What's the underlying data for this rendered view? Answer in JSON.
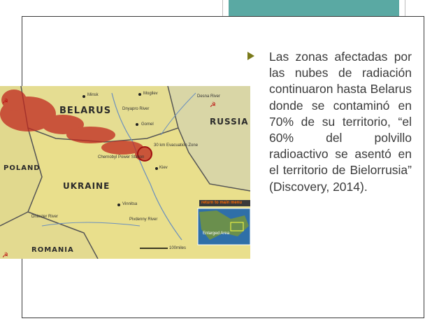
{
  "slide": {
    "bullet_icon": "right-triangle-icon",
    "bullet_text": "Las zonas afectadas por las nubes de radiación continuaron hasta Belarus donde se contaminó en 70% de su territorio, “el 60% del polvillo radioactivo se asentó en el territorio de Bielorrusia” (Discovery, 2014).",
    "accent_color": "#5aa9a3"
  },
  "map": {
    "labels": {
      "belarus": "BELARUS",
      "russia": "RUSSIA",
      "poland": "POLAND",
      "ukraine": "UKRAINE",
      "romania": "ROMANIA",
      "minsk": "Minsk",
      "mogilev": "Mogilev",
      "desna": "Desna River",
      "dnyapro": "Dnyapro River",
      "gomel": "Gomel",
      "chernobyl": "Chernobyl Power Station",
      "evac": "30 km Evacuation Zone",
      "kiev": "Kiev",
      "vinnitsa": "Vinnitsa",
      "pivdenny": "Pivdenny River",
      "dniester": "Dniester River",
      "return": "return to main menu",
      "enlarged": "Enlarged Area",
      "scale": "100miles"
    }
  }
}
